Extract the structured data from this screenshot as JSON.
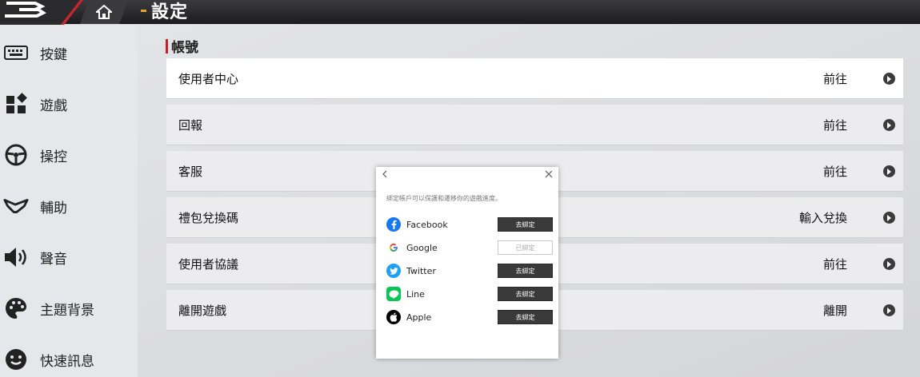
{
  "header": {
    "title": "設定"
  },
  "sidebar": {
    "items": [
      {
        "label": "按鍵",
        "icon": "keyboard-icon"
      },
      {
        "label": "遊戲",
        "icon": "widgets-icon"
      },
      {
        "label": "操控",
        "icon": "steering-wheel-icon"
      },
      {
        "label": "輔助",
        "icon": "assist-icon"
      },
      {
        "label": "聲音",
        "icon": "speaker-icon"
      },
      {
        "label": "主題背景",
        "icon": "palette-icon"
      },
      {
        "label": "快速訊息",
        "icon": "smiley-chat-icon"
      }
    ]
  },
  "main": {
    "section_title": "帳號",
    "rows": [
      {
        "label": "使用者中心",
        "action": "前往"
      },
      {
        "label": "回報",
        "action": "前往"
      },
      {
        "label": "客服",
        "action": "前往"
      },
      {
        "label": "禮包兌換碼",
        "action": "輸入兌換"
      },
      {
        "label": "使用者協議",
        "action": "前往"
      },
      {
        "label": "離開遊戲",
        "action": "離開"
      }
    ]
  },
  "modal": {
    "description": "綁定帳戶可以保護和遷移你的遊戲進度。",
    "accounts": [
      {
        "name": "Facebook",
        "button": "去綁定",
        "bound": false,
        "color": "#1877f2"
      },
      {
        "name": "Google",
        "button": "已綁定",
        "bound": true,
        "color": "#ffffff"
      },
      {
        "name": "Twitter",
        "button": "去綁定",
        "bound": false,
        "color": "#1da1f2"
      },
      {
        "name": "Line",
        "button": "去綁定",
        "bound": false,
        "color": "#06c755"
      },
      {
        "name": "Apple",
        "button": "去綁定",
        "bound": false,
        "color": "#000000"
      }
    ]
  }
}
